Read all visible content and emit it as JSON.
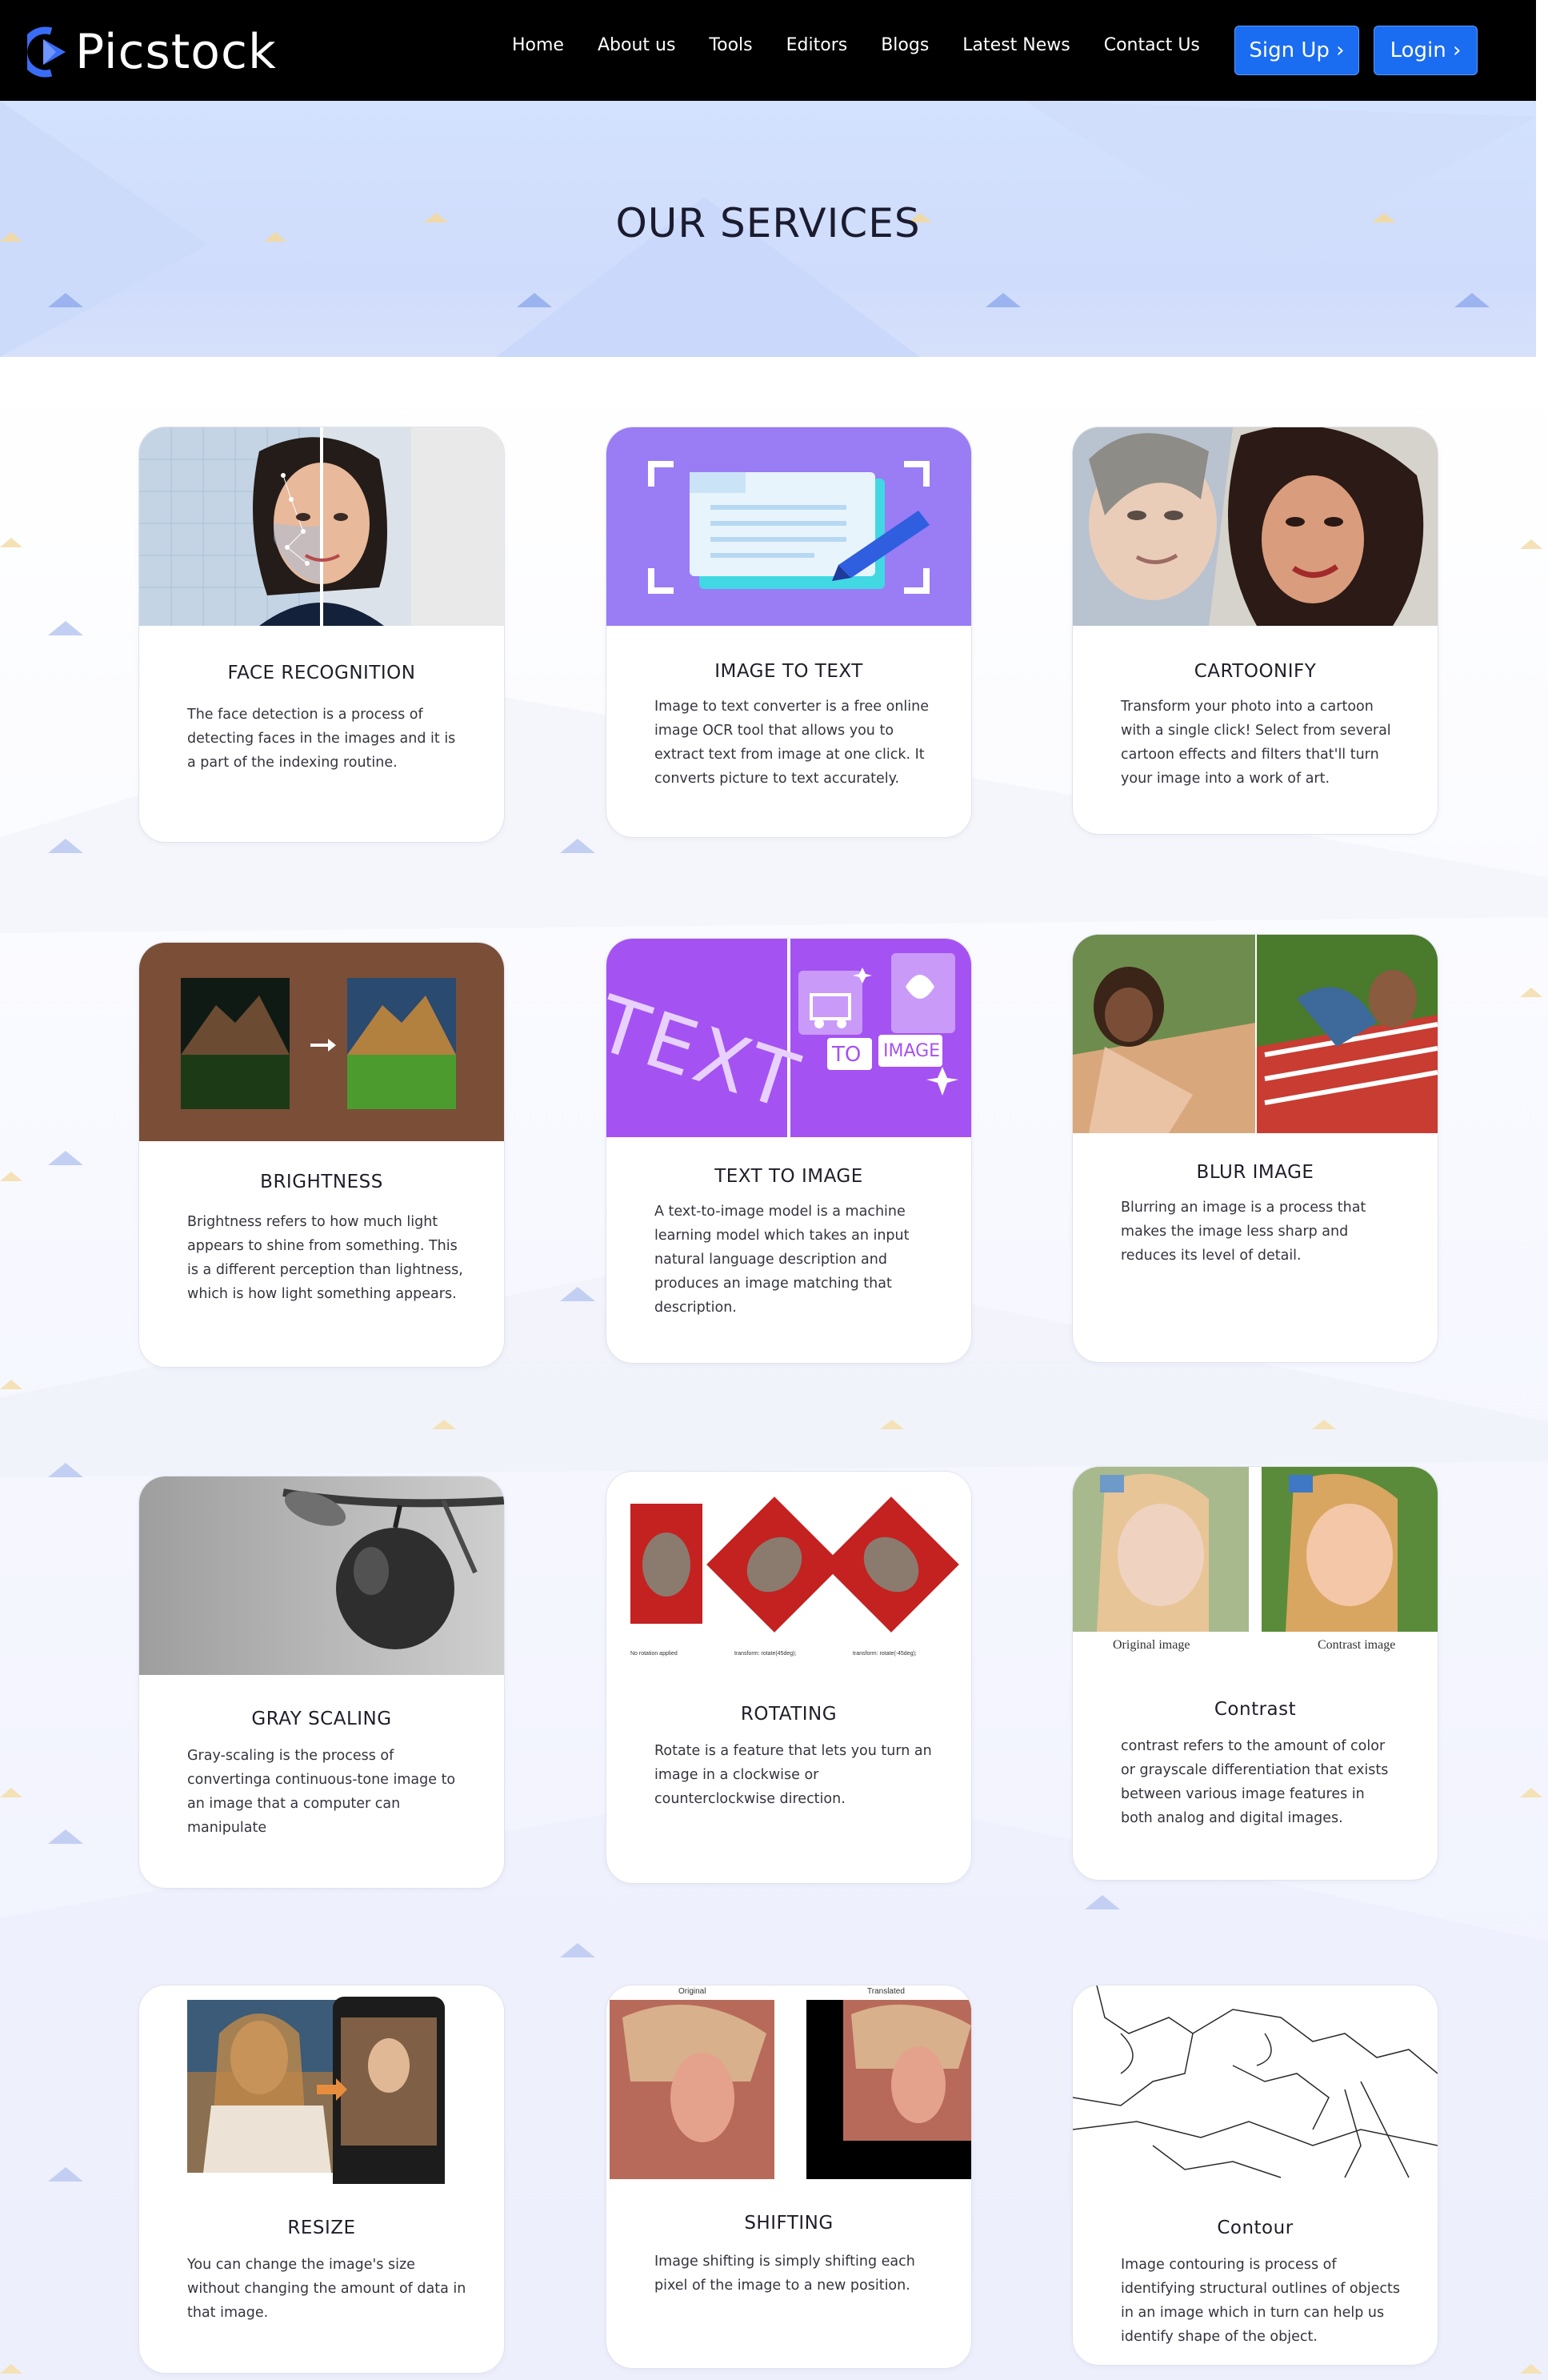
{
  "brand": {
    "name": "Picstock"
  },
  "nav": {
    "items": [
      "Home",
      "About us",
      "Tools",
      "Editors",
      "Blogs",
      "Latest News",
      "Contact Us"
    ],
    "signup": "Sign Up ›",
    "login": "Login ›"
  },
  "hero": {
    "title": "OUR SERVICES"
  },
  "colors": {
    "accent": "#1a6cf0",
    "hero_bg": "#d3e2ff",
    "purple": "#9a7cf5"
  },
  "cards": [
    {
      "title": "FACE RECOGNITION",
      "desc": "The face detection is a process of detecting faces in the images and it is a part of the indexing routine.",
      "icon": "face-recognition-image"
    },
    {
      "title": "IMAGE TO TEXT",
      "desc": "Image to text converter is a free online image OCR tool that allows you to extract text from image at one click. It converts picture to text accurately.",
      "icon": "document-scan-image"
    },
    {
      "title": "CARTOONIFY",
      "desc": "Transform your photo into a cartoon with a single click! Select from several cartoon effects and filters that'll turn your image into a work of art.",
      "icon": "cartoon-portrait-image"
    },
    {
      "title": "BRIGHTNESS",
      "desc": "Brightness refers to how much light appears to shine from something. This is a different perception than lightness, which is how light something appears.",
      "icon": "mountain-brightness-image"
    },
    {
      "title": "TEXT TO IMAGE",
      "desc": "A text-to-image model is a machine learning model which takes an input natural language description and produces an image matching that description.",
      "icon": "text-to-image-graphic",
      "img_text": {
        "text": "TEXT",
        "to": "TO",
        "image": "IMAGE"
      }
    },
    {
      "title": "BLUR IMAGE",
      "desc": "Blurring an image is a process that makes the image less sharp and reduces its level of detail.",
      "icon": "blur-photo-image"
    },
    {
      "title": "GRAY SCALING",
      "desc": "Gray-scaling is the process of convertinga continuous-tone image to an image that a computer can manipulate",
      "icon": "grayscale-apple-image"
    },
    {
      "title": "ROTATING",
      "desc": "Rotate is a feature that lets you turn an image in a clockwise or counterclockwise direction.",
      "icon": "rotating-cat-image",
      "captions": [
        "No rotation applied",
        "transform: rotate(45deg);",
        "transform: rotate(-45deg);"
      ]
    },
    {
      "title": "Contrast",
      "desc": "contrast refers to the amount of color or grayscale differentiation that exists between various image features in both analog and digital images.",
      "icon": "contrast-girl-image",
      "captions": [
        "Original image",
        "Contrast image"
      ]
    },
    {
      "title": "RESIZE",
      "desc": "You can change the image's size without changing the amount of data in that image.",
      "icon": "resize-phone-image"
    },
    {
      "title": "SHIFTING",
      "desc": "Image shifting is simply shifting each pixel of the image to a new position.",
      "icon": "shifting-portrait-image",
      "captions": [
        "Original",
        "Translated"
      ]
    },
    {
      "title": "Contour",
      "desc": "Image contouring is process of identifying structural outlines of objects in an image which in turn can help us identify shape of the object.",
      "icon": "contour-lines-image"
    }
  ]
}
